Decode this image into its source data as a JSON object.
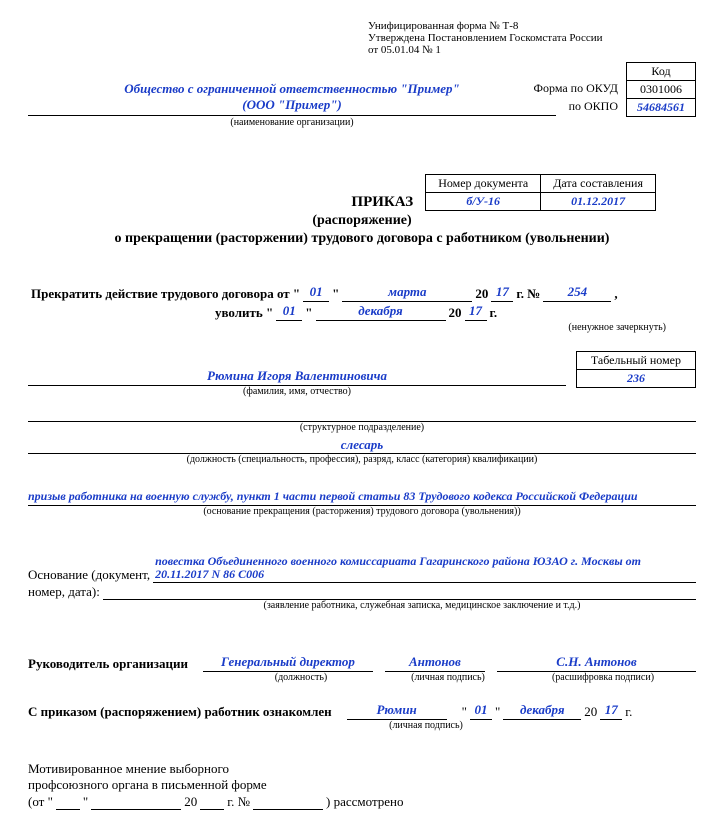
{
  "header": {
    "form_line1": "Унифицированная форма № Т-8",
    "form_line2": "Утверждена Постановлением Госкомстата России",
    "form_line3": "от 05.01.04 № 1"
  },
  "codes": {
    "kod_label": "Код",
    "okud_label": "Форма по ОКУД",
    "okud_value": "0301006",
    "okpo_label": "по ОКПО",
    "okpo_value": "54684561"
  },
  "org": {
    "name_line1": "Общество с ограниченной ответственностью \"Пример\"",
    "name_line2": "(ООО \"Пример\")",
    "sub": "(наименование организации)"
  },
  "docmeta": {
    "num_label": "Номер документа",
    "date_label": "Дата составления",
    "num_value": "б/У-16",
    "date_value": "01.12.2017"
  },
  "title": {
    "t1": "ПРИКАЗ",
    "t2": "(распоряжение)",
    "t3": "о прекращении (расторжении) трудового договора с работником (увольнении)"
  },
  "terminate": {
    "lead": "Прекратить действие трудового договора от \"",
    "day1": "01",
    "q1": "\"",
    "month1": "марта",
    "y1_prefix": "20",
    "y1": "17",
    "y1_suffix": "г.  №",
    "num": "254",
    "tail": ",",
    "lead2": "уволить \"",
    "day2": "01",
    "q2": "\"",
    "month2": "декабря",
    "y2_prefix": "20",
    "y2": "17",
    "y2_suffix": "г.",
    "note": "(ненужное зачеркнуть)"
  },
  "tab": {
    "label": "Табельный номер",
    "value": "236"
  },
  "person": {
    "fio": "Рюмина Игоря Валентиновича",
    "fio_sub": "(фамилия, имя, отчество)",
    "dept": "",
    "dept_sub": "(структурное подразделение)",
    "job": "слесарь",
    "job_sub": "(должность (специальность, профессия), разряд, класс (категория) квалификации)"
  },
  "reason": {
    "text": "призыв работника на военную службу, пункт 1 части первой статьи 83 Трудового кодекса Российской Федерации",
    "sub": "(основание прекращения (расторжения) трудового договора (увольнения))"
  },
  "basis": {
    "lead1": "Основание (документ,",
    "lead2": "номер, дата):",
    "text": "повестка Объединенного военного комиссариата Гагаринского района ЮЗАО г. Москвы от 20.11.2017 N 86 С006",
    "sub": "(заявление работника, служебная записка, медицинское заключение и т.д.)"
  },
  "head_sig": {
    "label": "Руководитель организации",
    "job": "Генеральный директор",
    "job_sub": "(должность)",
    "sign": "Антонов",
    "sign_sub": "(личная подпись)",
    "name": "С.Н. Антонов",
    "name_sub": "(расшифровка подписи)"
  },
  "ack": {
    "lead": "С приказом (распоряжением) работник ознакомлен",
    "sign": "Рюмин",
    "sign_sub": "(личная подпись)",
    "q1": "\"",
    "day": "01",
    "q2": "\"",
    "month": "декабря",
    "yprefix": "20",
    "y": "17",
    "ysuffix": "г."
  },
  "union": {
    "l1": "Мотивированное мнение выборного",
    "l2": "профсоюзного органа в письменной форме",
    "l3a": "(от \"",
    "day": "",
    "l3b": "\"",
    "month": "",
    "l3c": "20",
    "year": "",
    "l3d": "г. №",
    "num": "",
    "l3e": ") рассмотрено"
  }
}
